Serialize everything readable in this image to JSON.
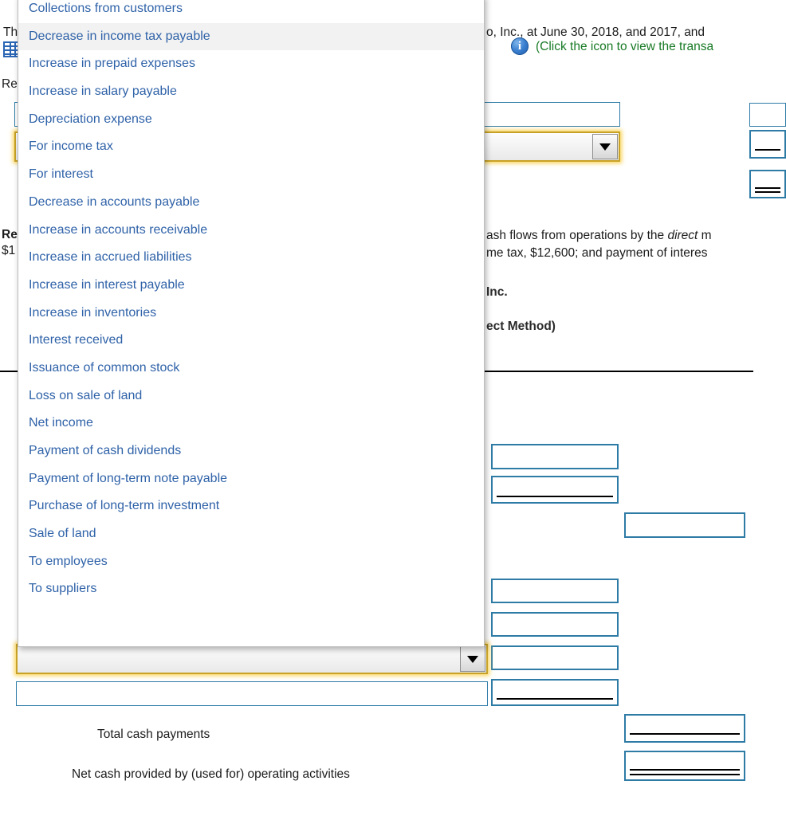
{
  "page": {
    "title_fragment_top": "Th",
    "intro_text_right": "o, Inc., at June 30, 2018, and 2017, and",
    "icon_hint": "(Click the icon to view the transa",
    "requirement_label_fragment": "Re",
    "req2_label_fragment": "Re",
    "req2_amount_fragment": "$1",
    "req_line1_right": "ash flows from operations by the ",
    "req_line1_italic": "direct",
    "req_line1_tail": " m",
    "req_line2_right": "me tax, $12,600; and payment of interes",
    "stmt_company_fragment": "Inc.",
    "stmt_method_fragment": "ect Method)"
  },
  "icons": {
    "info": "info-icon",
    "spreadsheet": "spreadsheet-icon",
    "dropdown_arrow": "chevron-down-icon"
  },
  "colors": {
    "link_blue": "#2f62a8",
    "input_border_teal": "#2e7ba6",
    "focus_yellow": "#f8cd3c",
    "green_hint": "#187a25",
    "highlight_gray": "#f2f2f2"
  },
  "dropdown": {
    "open": true,
    "selected_index": 1,
    "options": [
      "Collections from customers",
      "Decrease in income tax payable",
      "Increase in prepaid expenses",
      "Increase in salary payable",
      "Depreciation expense",
      "For income tax",
      "For interest",
      "Decrease in accounts payable",
      "Increase in accounts receivable",
      "Increase in accrued liabilities",
      "Increase in interest payable",
      "Increase in inventories",
      "Interest received",
      "Issuance of common stock",
      "Loss on sale of land",
      "Net income",
      "Payment of cash dividends",
      "Payment of long-term note payable",
      "Purchase of long-term investment",
      "Sale of land",
      "To employees",
      "To suppliers"
    ]
  },
  "statement_rows": [
    {
      "label": "Total cash payments",
      "value": "",
      "rule": "single"
    },
    {
      "label": "Net cash provided by (used for) operating activities",
      "value": "",
      "rule": "double"
    }
  ],
  "selects": {
    "top_select_value": "",
    "bottom_select_value": ""
  },
  "answer_fields": {
    "values": [
      "",
      "",
      "",
      "",
      "",
      "",
      "",
      "",
      "",
      "",
      "",
      "",
      ""
    ]
  }
}
